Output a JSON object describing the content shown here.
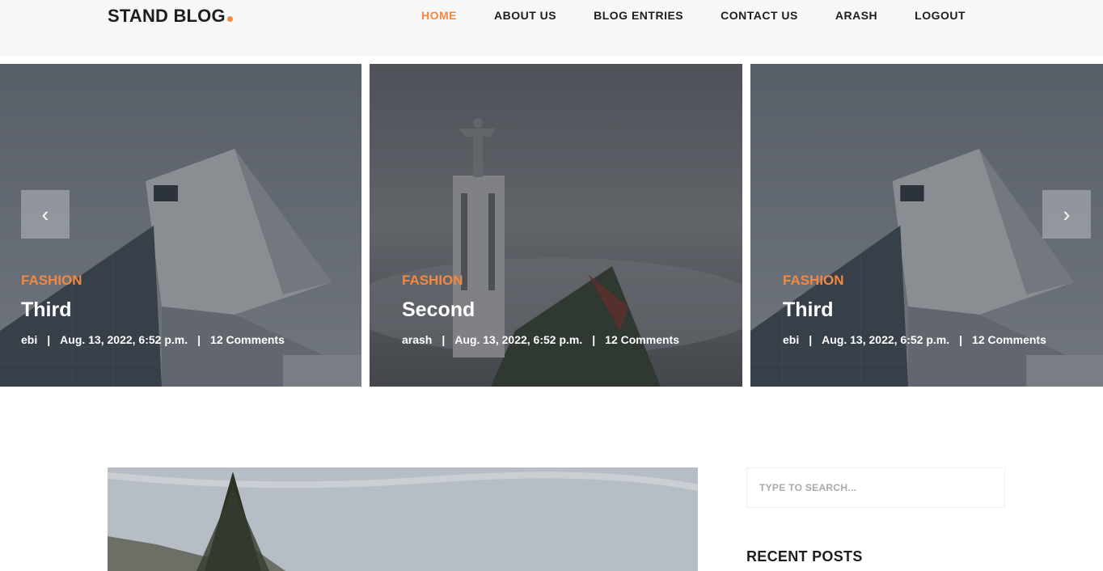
{
  "header": {
    "logo_text": "STAND BLOG",
    "nav": [
      {
        "label": "HOME",
        "active": true
      },
      {
        "label": "ABOUT US",
        "active": false
      },
      {
        "label": "BLOG ENTRIES",
        "active": false
      },
      {
        "label": "CONTACT US",
        "active": false
      },
      {
        "label": "ARASH",
        "active": false
      },
      {
        "label": "LOGOUT",
        "active": false
      }
    ]
  },
  "slider": {
    "prev_label": "‹",
    "next_label": "›",
    "slides": [
      {
        "category": "FASHION",
        "title": "Third",
        "author": "ebi",
        "sep1": "|",
        "date": "Aug. 13, 2022, 6:52 p.m.",
        "sep2": "|",
        "comments": "12 Comments"
      },
      {
        "category": "FASHION",
        "title": "Second",
        "author": "arash",
        "sep1": "|",
        "date": "Aug. 13, 2022, 6:52 p.m.",
        "sep2": "|",
        "comments": "12 Comments"
      },
      {
        "category": "FASHION",
        "title": "Third",
        "author": "ebi",
        "sep1": "|",
        "date": "Aug. 13, 2022, 6:52 p.m.",
        "sep2": "|",
        "comments": "12 Comments"
      }
    ]
  },
  "sidebar": {
    "search_placeholder": "TYPE TO SEARCH...",
    "recent_posts_heading": "RECENT POSTS"
  },
  "colors": {
    "accent": "#f48840",
    "header_bg": "#f7f7f7",
    "text_dark": "#1e1e1e"
  }
}
